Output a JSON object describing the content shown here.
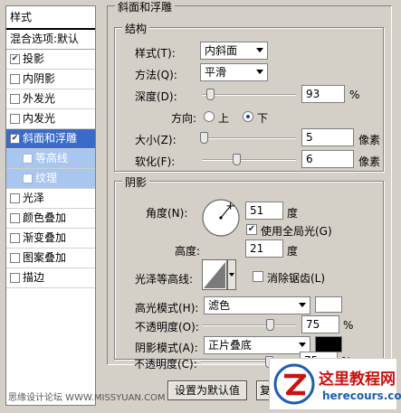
{
  "style_list": {
    "header": "样式",
    "blend_options": "混合选项:默认",
    "items": [
      {
        "label": "投影",
        "checked": true
      },
      {
        "label": "内阴影",
        "checked": false
      },
      {
        "label": "外发光",
        "checked": false
      },
      {
        "label": "内发光",
        "checked": false
      },
      {
        "label": "斜面和浮雕",
        "checked": true,
        "active": true
      },
      {
        "label": "等高线",
        "checked": false,
        "sub": true
      },
      {
        "label": "纹理",
        "checked": false,
        "sub": true
      },
      {
        "label": "光泽",
        "checked": false
      },
      {
        "label": "颜色叠加",
        "checked": false
      },
      {
        "label": "渐变叠加",
        "checked": false
      },
      {
        "label": "图案叠加",
        "checked": false
      },
      {
        "label": "描边",
        "checked": false
      }
    ],
    "footer": "思缘设计论坛 WWW.MISSYUAN.COM"
  },
  "bevel": {
    "title": "斜面和浮雕",
    "structure": {
      "title": "结构",
      "style_label": "样式(T):",
      "style_value": "内斜面",
      "technique_label": "方法(Q):",
      "technique_value": "平滑",
      "depth_label": "深度(D):",
      "depth_value": "93",
      "depth_unit": "%",
      "depth_fraction": 0.093,
      "direction_label": "方向:",
      "direction_up": "上",
      "direction_down": "下",
      "size_label": "大小(Z):",
      "size_value": "5",
      "size_unit": "像素",
      "size_fraction": 0.02,
      "soften_label": "软化(F):",
      "soften_value": "6",
      "soften_unit": "像素",
      "soften_fraction": 0.375
    },
    "shading": {
      "title": "阴影",
      "angle_label": "角度(N):",
      "angle_value": "51",
      "angle_unit": "度",
      "global_light_label": "使用全局光(G)",
      "global_light_checked": true,
      "altitude_label": "高度:",
      "altitude_value": "21",
      "altitude_unit": "度",
      "gloss_label": "光泽等高线:",
      "antialias_label": "消除锯齿(L)",
      "antialias_checked": false,
      "highlight_label": "高光模式(H):",
      "highlight_mode": "滤色",
      "highlight_color": "#ffffff",
      "highlight_opacity_label": "不透明度(O):",
      "highlight_opacity": "75",
      "opacity_unit": "%",
      "shadow_label": "阴影模式(A):",
      "shadow_mode": "正片叠底",
      "shadow_color": "#000000",
      "shadow_opacity_label": "不透明度(C):",
      "shadow_opacity": "75"
    },
    "set_default_button": "设置为默认值",
    "reset_button": "复"
  },
  "watermark": {
    "title": "这里教程网",
    "url": "herecours.com"
  },
  "colors": {
    "active_row": "#3b6bc8",
    "sub_row": "#a9c6ee",
    "watermark_red": "#cc1111",
    "watermark_blue": "#1d5fb0"
  }
}
